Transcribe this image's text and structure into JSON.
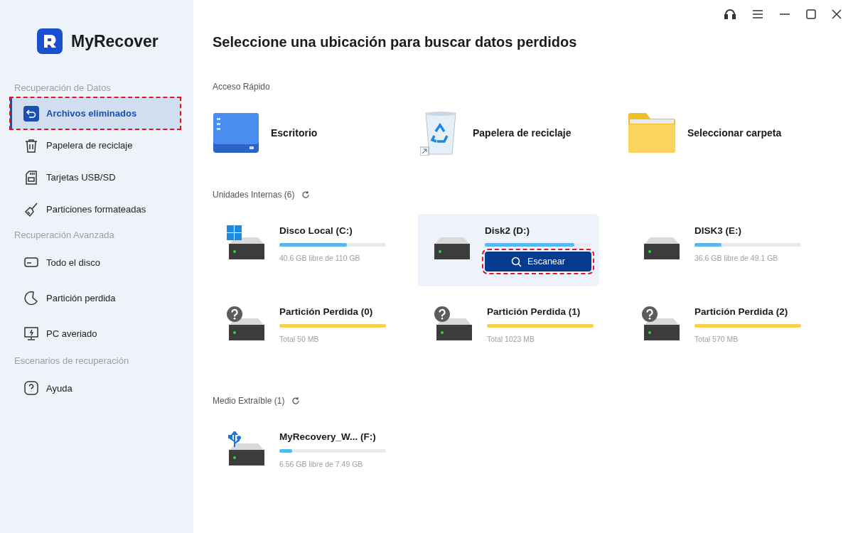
{
  "app": {
    "name": "MyRecover"
  },
  "sidebar": {
    "sections": [
      {
        "title": "Recuperación de Datos",
        "items": [
          {
            "label": "Archivos eliminados",
            "kind": "undo",
            "selected": true,
            "highlighted": true
          },
          {
            "label": "Papelera de reciclaje",
            "kind": "trash",
            "selected": false,
            "highlighted": false
          },
          {
            "label": "Tarjetas USB/SD",
            "kind": "sdcard",
            "selected": false,
            "highlighted": false
          },
          {
            "label": "Particiones formateadas",
            "kind": "broom",
            "selected": false,
            "highlighted": false
          }
        ]
      },
      {
        "title": "Recuperación Avanzada",
        "items": [
          {
            "label": "Todo el disco",
            "kind": "disk",
            "selected": false,
            "highlighted": false
          },
          {
            "label": "Partición perdida",
            "kind": "pie",
            "selected": false,
            "highlighted": false
          },
          {
            "label": "PC averiado",
            "kind": "monitor",
            "selected": false,
            "highlighted": false
          }
        ]
      },
      {
        "title": "Escenarios de recuperación",
        "items": [
          {
            "label": "Ayuda",
            "kind": "help",
            "selected": false,
            "highlighted": false
          }
        ]
      }
    ]
  },
  "main": {
    "title": "Seleccione una ubicación para buscar datos perdidos",
    "quick_access": {
      "title": "Acceso Rápido",
      "items": [
        {
          "label": "Escritorio",
          "kind": "desktop"
        },
        {
          "label": "Papelera de reciclaje",
          "kind": "recycle"
        },
        {
          "label": "Seleccionar carpeta",
          "kind": "folder"
        }
      ]
    },
    "sections": [
      {
        "title": "Unidades Internas (6)",
        "drives": [
          {
            "name": "Disco Local (C:)",
            "kind": "windows",
            "level": 0.63,
            "info": "40.6 GB libre de 110 GB",
            "selected": false
          },
          {
            "name": "Disk2 (D:)",
            "kind": "plain",
            "level": 0.84,
            "selected": true,
            "button": {
              "label": "Escanear",
              "highlighted": true
            }
          },
          {
            "name": "DISK3 (E:)",
            "kind": "plain",
            "level": 0.25,
            "info": "36.6 GB libre de 49.1 GB",
            "selected": false
          },
          {
            "name": "Partición Perdida (0)",
            "kind": "lost",
            "level": 1,
            "info": "Total 50 MB",
            "selected": false
          },
          {
            "name": "Partición Perdida (1)",
            "kind": "lost",
            "level": 1,
            "info": "Total 1023 MB",
            "selected": false
          },
          {
            "name": "Partición Perdida (2)",
            "kind": "lost",
            "level": 1,
            "info": "Total 570 MB",
            "selected": false
          }
        ]
      },
      {
        "title": "Medio Extraíble (1)",
        "drives": [
          {
            "name": "MyRecovery_W... (F:)",
            "kind": "usb",
            "level": 0.12,
            "info": "6.56 GB libre de 7.49 GB",
            "selected": false
          }
        ]
      }
    ]
  }
}
